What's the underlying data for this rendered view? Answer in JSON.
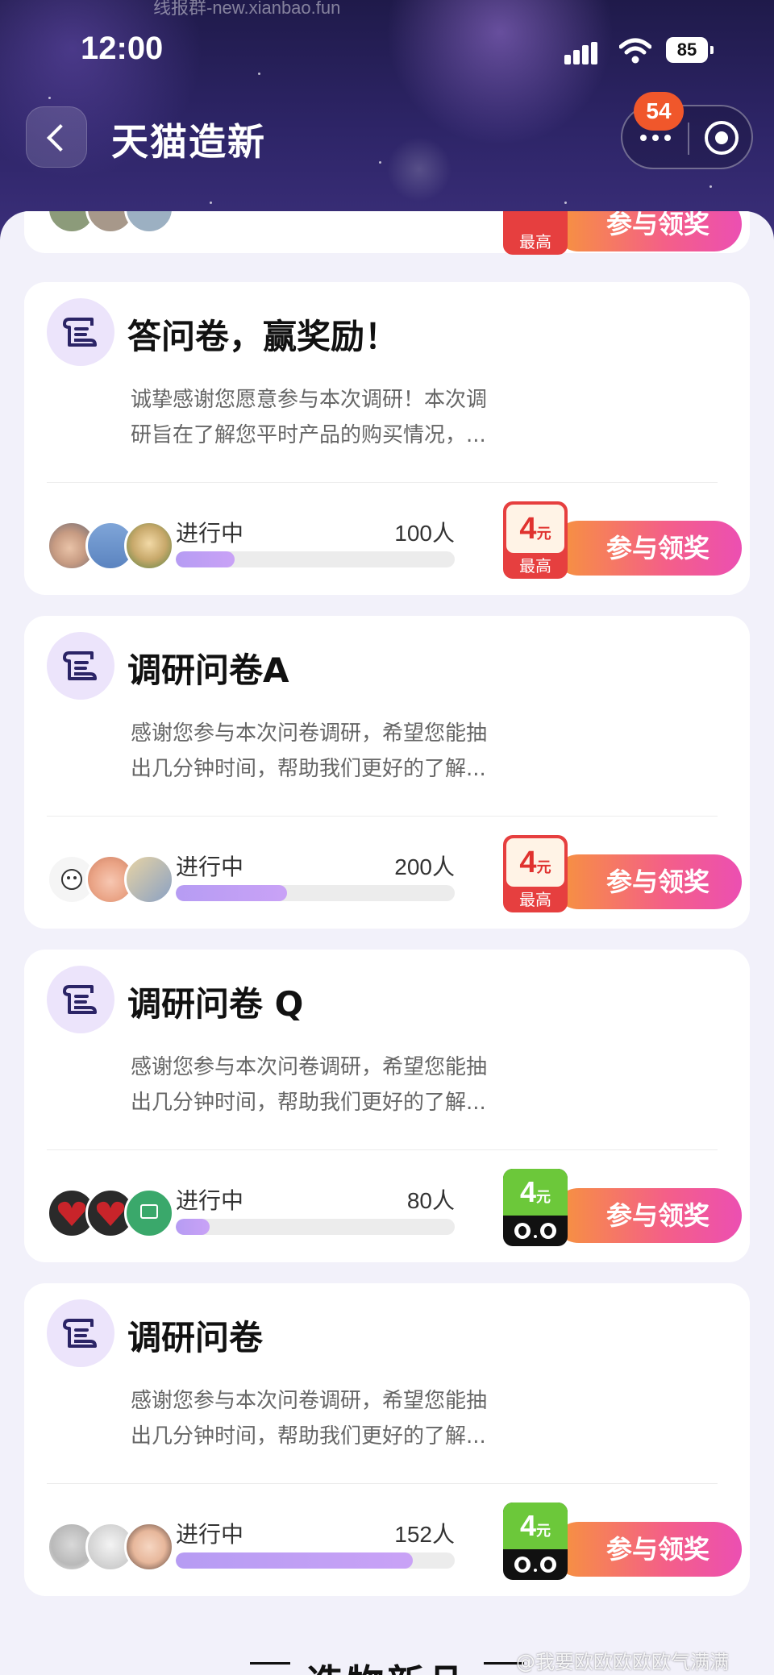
{
  "status_bar": {
    "url_text": "线报群-new.xianbao.fun",
    "time": "12:00",
    "battery": "85"
  },
  "nav": {
    "title": "天猫造新",
    "badge": "54"
  },
  "cards": [
    {
      "title": "",
      "status": "",
      "count": "",
      "progress": 0.0,
      "reward": {
        "style": "red",
        "amount": "",
        "unit": "",
        "tag": "最高"
      },
      "button": "参与领奖"
    },
    {
      "title": "答问卷，赢奖励！",
      "desc": [
        "诚挚感谢您愿意参与本次调研！本次调",
        "研旨在了解您平时产品的购买情况，..."
      ],
      "status": "进行中",
      "count": "100人",
      "progress": 0.21,
      "reward": {
        "style": "red",
        "amount": "4",
        "unit": "元",
        "tag": "最高"
      },
      "button": "参与领奖"
    },
    {
      "title": "调研问卷A",
      "desc": [
        "感谢您参与本次问卷调研，希望您能抽",
        "出几分钟时间，帮助我们更好的了解..."
      ],
      "status": "进行中",
      "count": "200人",
      "progress": 0.4,
      "reward": {
        "style": "red",
        "amount": "4",
        "unit": "元",
        "tag": "最高"
      },
      "button": "参与领奖"
    },
    {
      "title": "调研问卷 Q",
      "desc": [
        "感谢您参与本次问卷调研，希望您能抽",
        "出几分钟时间，帮助我们更好的了解..."
      ],
      "status": "进行中",
      "count": "80人",
      "progress": 0.12,
      "reward": {
        "style": "green",
        "amount": "4",
        "unit": "元",
        "tag": ""
      },
      "button": "参与领奖"
    },
    {
      "title": "调研问卷",
      "desc": [
        "感谢您参与本次问卷调研，希望您能抽",
        "出几分钟时间，帮助我们更好的了解..."
      ],
      "status": "进行中",
      "count": "152人",
      "progress": 0.85,
      "reward": {
        "style": "green",
        "amount": "4",
        "unit": "元",
        "tag": ""
      },
      "button": "参与领奖"
    }
  ],
  "footer": {
    "section_title": "造物新品",
    "watermark": "@我要欧欧欧欧欧气满满"
  },
  "colors": {
    "accent_purple": "#b69cf3",
    "cta_orange": "#f7963a",
    "cta_pink": "#ec4fb2",
    "reward_red": "#e63f3f",
    "reward_green": "#6cc83a",
    "badge": "#f0572b"
  },
  "icons": [
    "chevron-left-icon",
    "more-dots-icon",
    "target-icon",
    "survey-scroll-icon",
    "signal-icon",
    "wifi-icon",
    "battery-icon",
    "tmall-cat-icon"
  ]
}
